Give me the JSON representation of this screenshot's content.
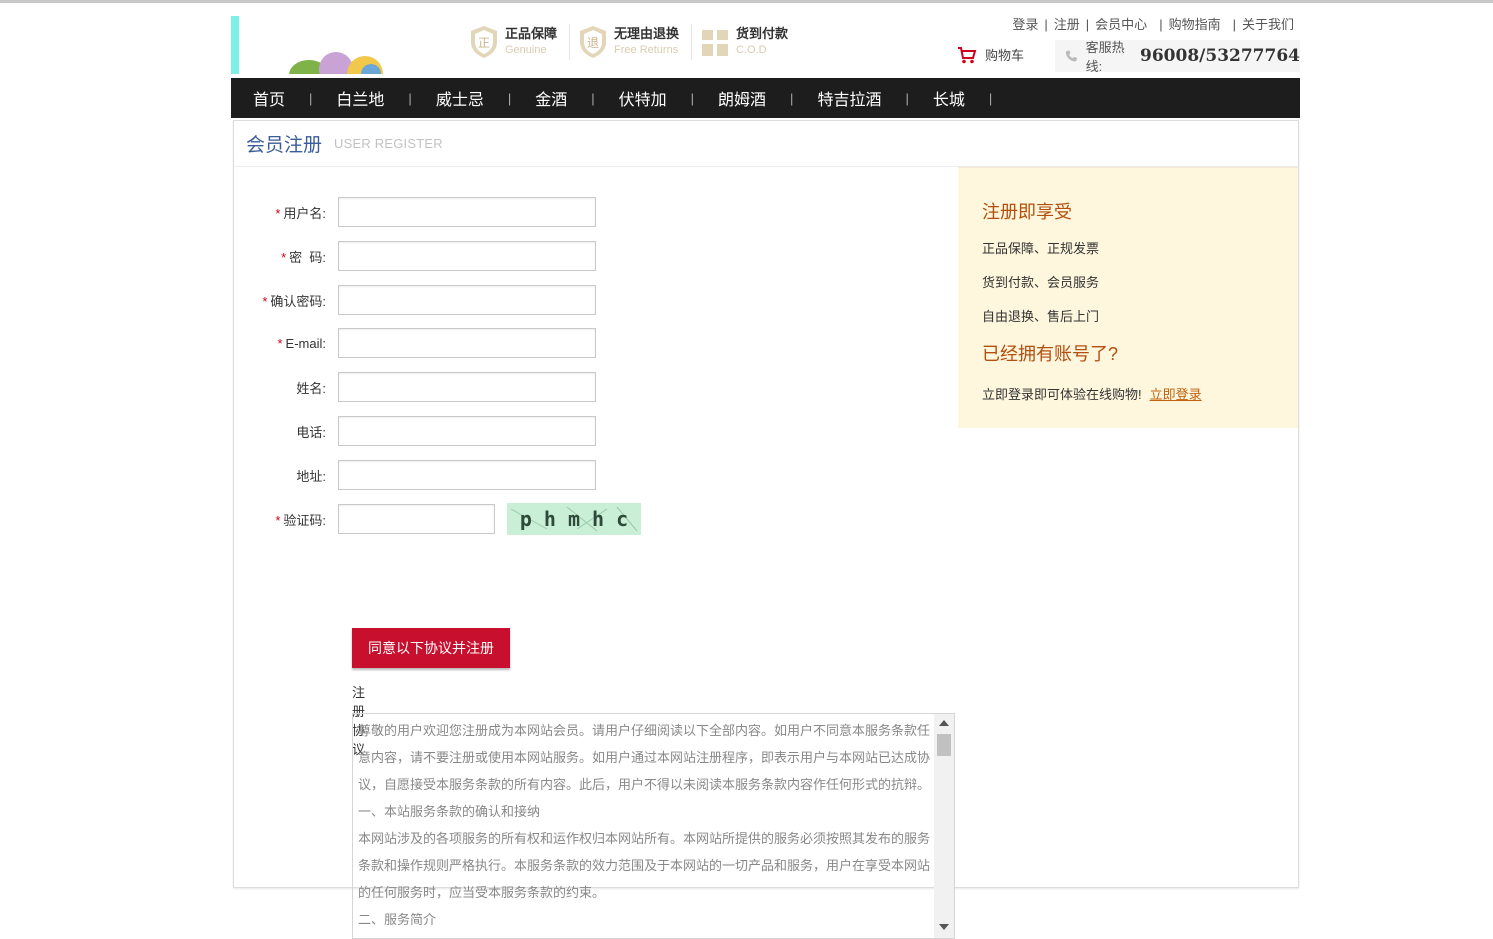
{
  "header": {
    "badges": [
      {
        "title": "正品保障",
        "sub": "Genuine",
        "icon": "genuine-shield-icon",
        "glyph": "正"
      },
      {
        "title": "无理由退换",
        "sub": "Free Returns",
        "icon": "returns-shield-icon",
        "glyph": "退"
      },
      {
        "title": "货到付款",
        "sub": "C.O.D",
        "icon": "gift-box-icon",
        "glyph": ""
      }
    ],
    "toplinks": [
      "登录",
      "注册",
      "会员中心",
      "购物指南",
      "关于我们"
    ],
    "cart_label": "购物车",
    "hotline_label": "客服热线:",
    "hotline_number": "96008/53277764"
  },
  "nav": [
    "首页",
    "白兰地",
    "威士忌",
    "金酒",
    "伏特加",
    "朗姆酒",
    "特吉拉酒",
    "长城"
  ],
  "nav_separator": "|",
  "page": {
    "title_cn": "会员注册",
    "title_en": "USER REGISTER"
  },
  "form": {
    "fields": [
      {
        "label": "用户名:",
        "required": true
      },
      {
        "label": "密  码:",
        "required": true
      },
      {
        "label": "确认密码:",
        "required": true
      },
      {
        "label": "E-mail:",
        "required": true
      },
      {
        "label": "姓名:",
        "required": false
      },
      {
        "label": "电话:",
        "required": false
      },
      {
        "label": "地址:",
        "required": false
      },
      {
        "label": "验证码:",
        "required": true
      }
    ],
    "required_mark": "*",
    "captcha_text": "p h m h c",
    "submit_label": "同意以下协议并注册",
    "agreement_label": "注册协议",
    "agreement_text": "尊敬的用户欢迎您注册成为本网站会员。请用户仔细阅读以下全部内容。如用户不同意本服务条款任意内容，请不要注册或使用本网站服务。如用户通过本网站注册程序，即表示用户与本网站已达成协议，自愿接受本服务条款的所有内容。此后，用户不得以未阅读本服务条款内容作任何形式的抗辩。\n一、本站服务条款的确认和接纳\n本网站涉及的各项服务的所有权和运作权归本网站所有。本网站所提供的服务必须按照其发布的服务条款和操作规则严格执行。本服务条款的效力范围及于本网站的一切产品和服务，用户在享受本网站的任何服务时，应当受本服务条款的约束。\n二、服务简介"
  },
  "side": {
    "title": "注册即享受",
    "benefits": [
      "正品保障、正规发票",
      "货到付款、会员服务",
      "自由退换、售后上门"
    ],
    "title2": "已经拥有账号了?",
    "login_text": "立即登录即可体验在线购物!",
    "login_link": "立即登录"
  },
  "colors": {
    "accent_red": "#c8102e",
    "nav_bg": "#1d1d1d",
    "side_bg": "#fef6dd",
    "side_title": "#b44e0c",
    "title_blue": "#3a5d9a"
  }
}
